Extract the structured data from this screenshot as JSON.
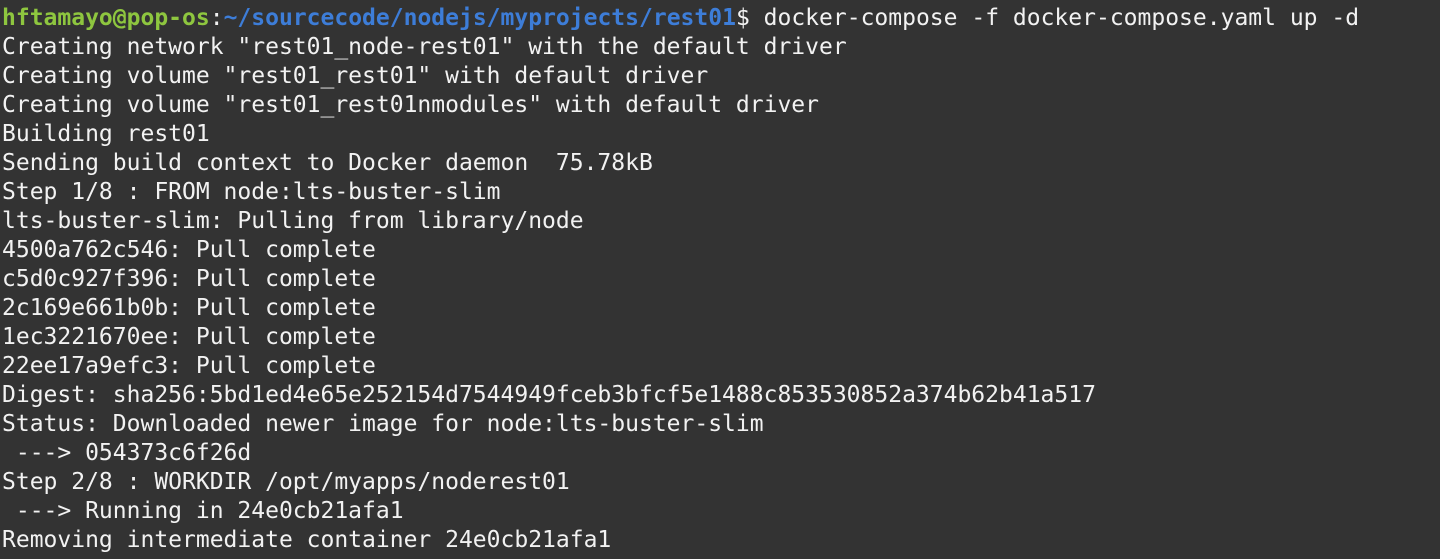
{
  "terminal": {
    "colors": {
      "background": "#333333",
      "text": "#f2f2f2",
      "prompt_user": "#8ec63f",
      "prompt_path": "#3d7dd8"
    },
    "prompt": {
      "user_host": "hftamayo@pop-os",
      "separator": ":",
      "path": "~/sourcecode/nodejs/myprojects/rest01",
      "symbol": "$",
      "command": " docker-compose -f docker-compose.yaml up -d"
    },
    "output_lines": [
      "Creating network \"rest01_node-rest01\" with the default driver",
      "Creating volume \"rest01_rest01\" with default driver",
      "Creating volume \"rest01_rest01nmodules\" with default driver",
      "Building rest01",
      "Sending build context to Docker daemon  75.78kB",
      "Step 1/8 : FROM node:lts-buster-slim",
      "lts-buster-slim: Pulling from library/node",
      "4500a762c546: Pull complete",
      "c5d0c927f396: Pull complete",
      "2c169e661b0b: Pull complete",
      "1ec3221670ee: Pull complete",
      "22ee17a9efc3: Pull complete",
      "Digest: sha256:5bd1ed4e65e252154d7544949fceb3bfcf5e1488c853530852a374b62b41a517",
      "Status: Downloaded newer image for node:lts-buster-slim",
      " ---> 054373c6f26d",
      "Step 2/8 : WORKDIR /opt/myapps/noderest01",
      " ---> Running in 24e0cb21afa1",
      "Removing intermediate container 24e0cb21afa1"
    ]
  }
}
